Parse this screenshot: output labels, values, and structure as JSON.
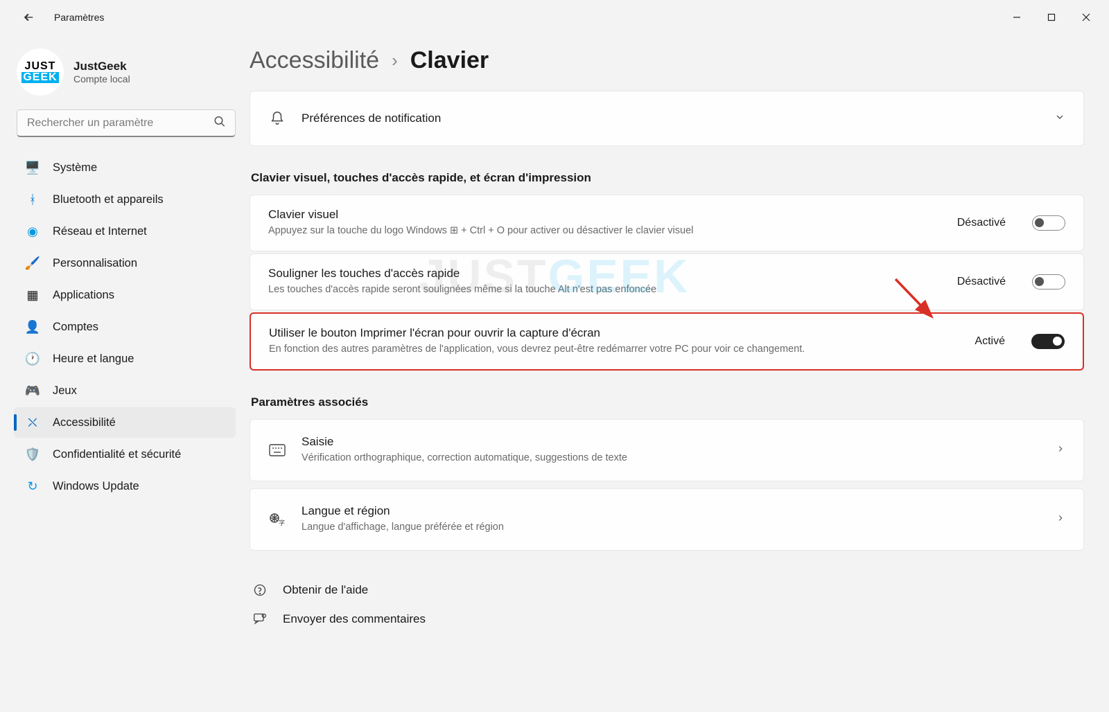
{
  "app_title": "Paramètres",
  "profile": {
    "name": "JustGeek",
    "sub": "Compte local",
    "avatar_l1": "JUST",
    "avatar_l2": "GEEK"
  },
  "search": {
    "placeholder": "Rechercher un paramètre"
  },
  "nav": [
    {
      "label": "Système"
    },
    {
      "label": "Bluetooth et appareils"
    },
    {
      "label": "Réseau et Internet"
    },
    {
      "label": "Personnalisation"
    },
    {
      "label": "Applications"
    },
    {
      "label": "Comptes"
    },
    {
      "label": "Heure et langue"
    },
    {
      "label": "Jeux"
    },
    {
      "label": "Accessibilité"
    },
    {
      "label": "Confidentialité et sécurité"
    },
    {
      "label": "Windows Update"
    }
  ],
  "breadcrumb": {
    "parent": "Accessibilité",
    "sep": "›",
    "current": "Clavier"
  },
  "notif_card": {
    "title": "Préférences de notification"
  },
  "section1_title": "Clavier visuel, touches d'accès rapide, et écran d'impression",
  "toggles": [
    {
      "title": "Clavier visuel",
      "sub": "Appuyez sur la touche du logo Windows ⊞ + Ctrl + O pour activer ou désactiver le clavier visuel",
      "state": "Désactivé",
      "on": false
    },
    {
      "title": "Souligner les touches d'accès rapide",
      "sub": "Les touches d'accès rapide seront soulignées même si la touche Alt n'est pas enfoncée",
      "state": "Désactivé",
      "on": false
    },
    {
      "title": "Utiliser le bouton Imprimer l'écran pour ouvrir la capture d'écran",
      "sub": "En fonction des autres paramètres de l'application, vous devrez peut-être redémarrer votre PC pour voir ce changement.",
      "state": "Activé",
      "on": true
    }
  ],
  "section2_title": "Paramètres associés",
  "related": [
    {
      "title": "Saisie",
      "sub": "Vérification orthographique, correction automatique, suggestions de texte"
    },
    {
      "title": "Langue et région",
      "sub": "Langue d'affichage, langue préférée et région"
    }
  ],
  "footer": {
    "help": "Obtenir de l'aide",
    "feedback": "Envoyer des commentaires"
  },
  "watermark": {
    "w1": "JUST",
    "w2": "GEEK"
  }
}
